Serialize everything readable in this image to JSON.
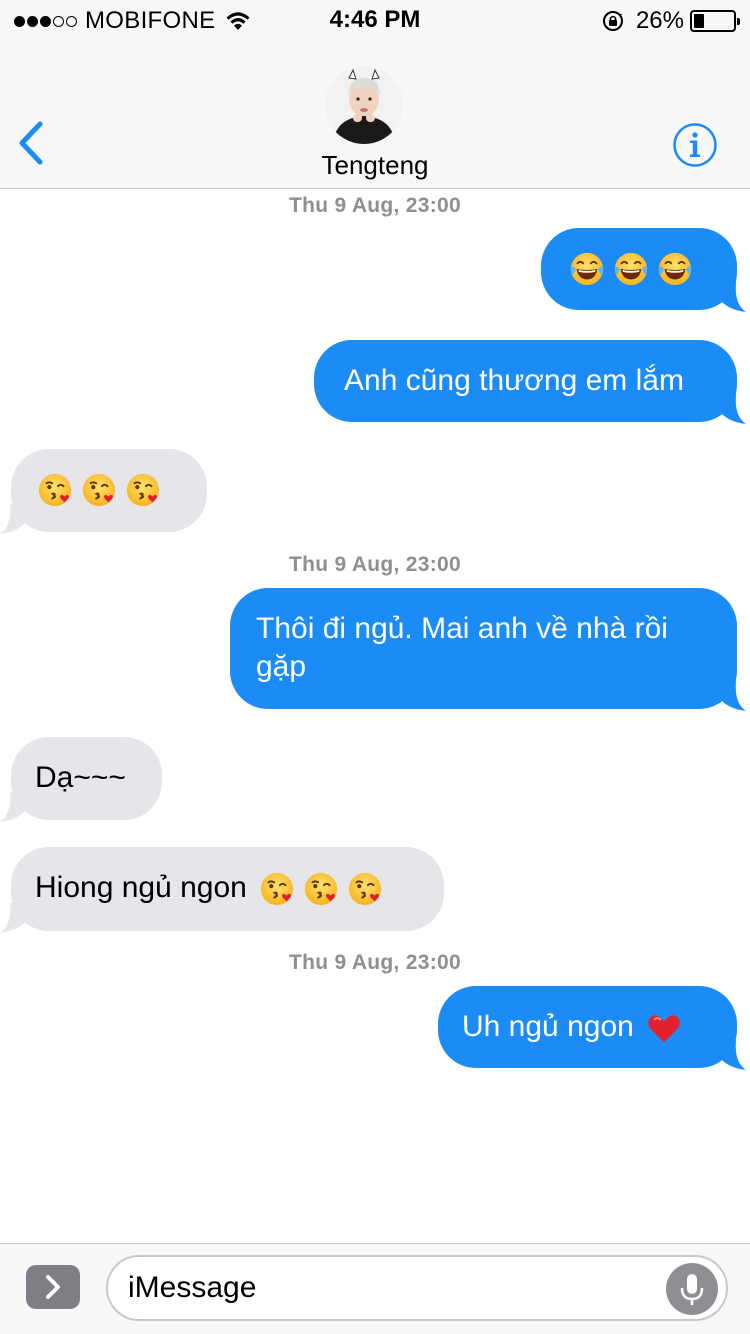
{
  "status_bar": {
    "carrier": "MOBIFONE",
    "time": "4:46 PM",
    "battery": "26%",
    "battery_level": 0.26,
    "signal_bars_filled": 3,
    "signal_bars_total": 5
  },
  "header": {
    "contact_name": "Tengteng",
    "back_icon": "chevron-left-icon",
    "info_icon": "info-icon",
    "accent_color": "#1b8bf5"
  },
  "messages": {
    "timestamp_1": "Thu 9 Aug, 23:00",
    "msg_1_emoji": "face-with-tears-of-joy x3",
    "msg_2": "Anh cũng thương em lắm",
    "msg_3_emoji": "face-blowing-kiss x3",
    "timestamp_2": "Thu 9 Aug, 23:00",
    "msg_4": "Thôi đi ngủ. Mai anh về nhà rồi gặp",
    "msg_4_line1": "Thôi đi ngủ. Mai anh về nhà rồi",
    "msg_4_line2": "gặp",
    "msg_5": "Dạ~~~",
    "msg_6": "Hiong ngủ ngon",
    "timestamp_3": "Thu 9 Aug, 23:00",
    "msg_7": "Uh ngủ ngon",
    "msg_7_emoji": "red-heart"
  },
  "input_bar": {
    "placeholder": "iMessage",
    "apps_icon": "chevron-right-icon",
    "mic_icon": "microphone-icon"
  },
  "colors": {
    "outgoing_bubble": "#1b8bf5",
    "incoming_bubble": "#e5e5ea",
    "timestamp": "#8e8e93"
  }
}
